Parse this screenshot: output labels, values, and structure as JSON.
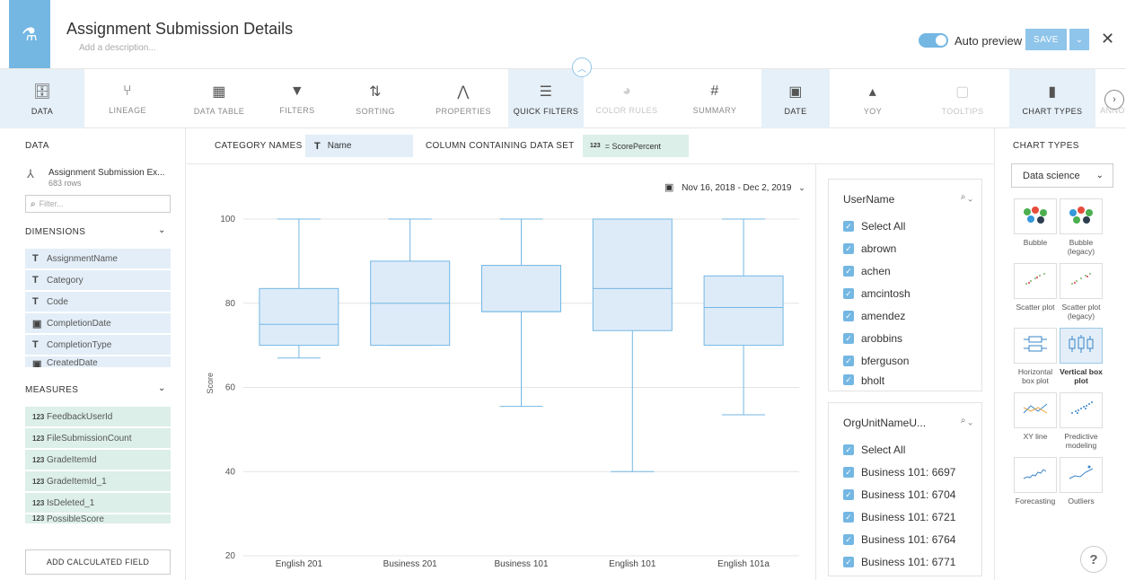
{
  "header": {
    "title": "Assignment Submission Details",
    "subtitle": "Add a description...",
    "auto_preview_label": "Auto preview",
    "save_label": "SAVE",
    "accent": "#74b7e3"
  },
  "toolbar": [
    {
      "label": "DATA",
      "icon": "database-icon",
      "glyph": "🗄"
    },
    {
      "label": "LINEAGE",
      "icon": "lineage-icon",
      "glyph": "⑂"
    },
    {
      "label": "DATA TABLE",
      "icon": "table-icon",
      "glyph": "▦"
    },
    {
      "label": "FILTERS",
      "icon": "filter-icon",
      "glyph": "▼"
    },
    {
      "label": "SORTING",
      "icon": "sort-icon",
      "glyph": "⇅"
    },
    {
      "label": "PROPERTIES",
      "icon": "properties-icon",
      "glyph": "⋀"
    },
    {
      "label": "QUICK FILTERS",
      "icon": "quick-filters-icon",
      "glyph": "☰"
    },
    {
      "label": "COLOR RULES",
      "icon": "palette-icon",
      "glyph": "◕"
    },
    {
      "label": "SUMMARY",
      "icon": "hash-icon",
      "glyph": "#"
    },
    {
      "label": "DATE",
      "icon": "calendar-icon",
      "glyph": "▣"
    },
    {
      "label": "YOY",
      "icon": "yoy-icon",
      "glyph": "▴"
    },
    {
      "label": "TOOLTIPS",
      "icon": "tooltip-icon",
      "glyph": "▢"
    },
    {
      "label": "CHART TYPES",
      "icon": "chart-types-icon",
      "glyph": "▮"
    },
    {
      "label": "ANNO",
      "icon": "annotation-icon",
      "glyph": ""
    }
  ],
  "left": {
    "data_label": "DATA",
    "dataset_name": "Assignment Submission Ex...",
    "dataset_rows": "683 rows",
    "filter_placeholder": "Filter...",
    "dimensions_label": "DIMENSIONS",
    "dimensions": [
      {
        "type": "T",
        "name": "AssignmentName"
      },
      {
        "type": "T",
        "name": "Category"
      },
      {
        "type": "T",
        "name": "Code"
      },
      {
        "type": "date",
        "name": "CompletionDate"
      },
      {
        "type": "T",
        "name": "CompletionType"
      },
      {
        "type": "date",
        "name": "CreatedDate"
      }
    ],
    "measures_label": "MEASURES",
    "measures": [
      {
        "type": "123",
        "name": "FeedbackUserId"
      },
      {
        "type": "123",
        "name": "FileSubmissionCount"
      },
      {
        "type": "123",
        "name": "GradeItemId"
      },
      {
        "type": "123",
        "name": "GradeItemId_1"
      },
      {
        "type": "123",
        "name": "IsDeleted_1"
      },
      {
        "type": "123",
        "name": "PossibleScore"
      }
    ],
    "add_calc_label": "ADD CALCULATED FIELD"
  },
  "config": {
    "category_label": "CATEGORY NAMES",
    "category_value": "Name",
    "category_type": "T",
    "column_label": "COLUMN CONTAINING DATA SET",
    "column_value": "= ScorePercent",
    "column_type": "123"
  },
  "date_range": "Nov 16, 2018 - Dec 2, 2019",
  "chart_data": {
    "type": "box",
    "ylabel": "Score",
    "ylim": [
      20,
      100
    ],
    "yticks": [
      20,
      40,
      60,
      80,
      100
    ],
    "color": "#74b7e3",
    "fill": "#ddebf9",
    "categories": [
      "English 201",
      "Business 201",
      "Business 101",
      "English 101",
      "English 101a"
    ],
    "boxes": [
      {
        "min": 67,
        "q1": 70,
        "median": 75,
        "q3": 83.5,
        "max": 100
      },
      {
        "min": 70,
        "q1": 70,
        "median": 80,
        "q3": 90,
        "max": 100
      },
      {
        "min": 55.5,
        "q1": 78,
        "median": 78,
        "q3": 89,
        "max": 100
      },
      {
        "min": 40,
        "q1": 73.5,
        "median": 83.5,
        "q3": 100,
        "max": 100
      },
      {
        "min": 53.5,
        "q1": 70,
        "median": 79,
        "q3": 86.5,
        "max": 100
      }
    ]
  },
  "filters": [
    {
      "title": "UserName",
      "items": [
        "Select All",
        "abrown",
        "achen",
        "amcintosh",
        "amendez",
        "arobbins",
        "bferguson",
        "bholt"
      ]
    },
    {
      "title": "OrgUnitNameU...",
      "items": [
        "Select All",
        "Business 101: 6697",
        "Business 101: 6704",
        "Business 101: 6721",
        "Business 101: 6764",
        "Business 101: 6771"
      ]
    }
  ],
  "chart_types": {
    "title": "CHART TYPES",
    "category": "Data science",
    "items": [
      {
        "label": "Bubble",
        "icon": "bubble-chart-icon"
      },
      {
        "label": "Bubble (legacy)",
        "icon": "bubble-legacy-icon"
      },
      {
        "label": "Scatter plot",
        "icon": "scatter-icon"
      },
      {
        "label": "Scatter plot (legacy)",
        "icon": "scatter-legacy-icon"
      },
      {
        "label": "Horizontal box plot",
        "icon": "horizontal-box-icon"
      },
      {
        "label": "Vertical box plot",
        "icon": "vertical-box-icon",
        "selected": true
      },
      {
        "label": "XY line",
        "icon": "xy-line-icon"
      },
      {
        "label": "Predictive modeling",
        "icon": "predictive-icon"
      },
      {
        "label": "Forecasting",
        "icon": "forecasting-icon"
      },
      {
        "label": "Outliers",
        "icon": "outliers-icon"
      }
    ]
  },
  "help_label": "?"
}
